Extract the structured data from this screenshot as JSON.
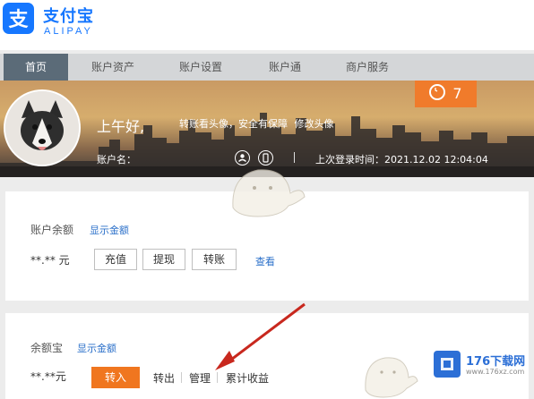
{
  "brand": {
    "name_cn": "支付宝",
    "name_en": "ALIPAY"
  },
  "nav": {
    "items": [
      {
        "label": "首页",
        "active": true
      },
      {
        "label": "账户资产",
        "active": false
      },
      {
        "label": "账户设置",
        "active": false
      },
      {
        "label": "账户通",
        "active": false
      },
      {
        "label": "商户服务",
        "active": false
      }
    ]
  },
  "banner": {
    "greeting": "上午好,",
    "slogan_prefix": "转账看头像，",
    "slogan_secure": "安全有保障",
    "slogan_link": "修改头像",
    "account_label": "账户名：",
    "last_login": "上次登录时间：2021.12.02 12:04:04",
    "message_count": "7"
  },
  "balance": {
    "title": "账户余额",
    "show_link": "显示金额",
    "amount": "**.** 元",
    "buttons": {
      "recharge": "充值",
      "withdraw": "提现",
      "transfer": "转账"
    },
    "view_link": "查看"
  },
  "yuebao": {
    "title": "余额宝",
    "show_link": "显示金额",
    "amount": "**.**元",
    "buttons": {
      "transfer_in": "转入"
    },
    "links": {
      "transfer_out": "转出",
      "manage": "管理",
      "earnings": "累计收益"
    }
  },
  "watermark": {
    "site_cn": "176下载网",
    "site_en": "www.176xz.com"
  },
  "colors": {
    "brand_blue": "#1677ff",
    "accent_orange": "#f0761f",
    "nav_active": "#5b6b78",
    "annotation_red": "#c8281e"
  }
}
